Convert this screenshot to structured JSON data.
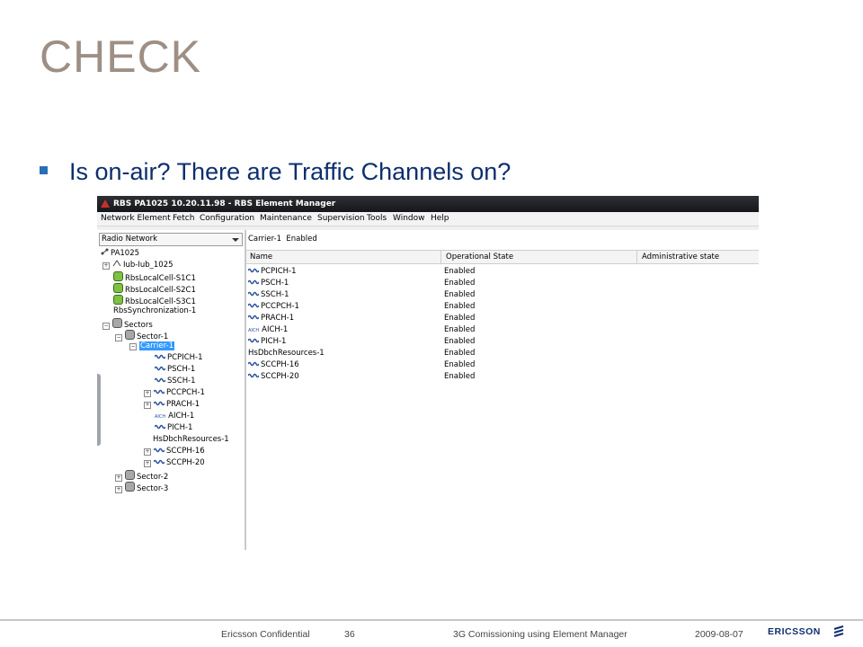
{
  "slide": {
    "title": "CHECK",
    "bullet": "Is on-air? There are Traffic Channels on?"
  },
  "window": {
    "title": "RBS PA1025 10.20.11.98 - RBS Element Manager",
    "menu": [
      "Network Element",
      "Fetch",
      "Configuration",
      "Maintenance",
      "Supervision",
      "Tools",
      "Window",
      "Help"
    ]
  },
  "tree": {
    "combo_value": "Radio Network",
    "items": [
      {
        "label": "PA1025"
      },
      {
        "label": "Iub-Iub_1025"
      },
      {
        "label": "RbsLocalCell-S1C1"
      },
      {
        "label": "RbsLocalCell-S2C1"
      },
      {
        "label": "RbsLocalCell-S3C1"
      },
      {
        "label": "RbsSynchronization-1"
      },
      {
        "label": "Sectors"
      },
      {
        "label": "Sector-1"
      },
      {
        "label": "Carrier-1"
      },
      {
        "label": "PCPICH-1"
      },
      {
        "label": "PSCH-1"
      },
      {
        "label": "SSCH-1"
      },
      {
        "label": "PCCPCH-1"
      },
      {
        "label": "PRACH-1"
      },
      {
        "label": "AICH-1"
      },
      {
        "label": "PICH-1"
      },
      {
        "label": "HsDbchResources-1"
      },
      {
        "label": "SCCPH-16"
      },
      {
        "label": "SCCPH-20"
      },
      {
        "label": "Sector-2"
      },
      {
        "label": "Sector-3"
      }
    ],
    "aich_icon_text": "AICH"
  },
  "detail": {
    "header_name": "Carrier-1",
    "header_state": "Enabled",
    "columns": [
      "Name",
      "Operational State",
      "Administrative state"
    ],
    "rows": [
      {
        "name": "PCPICH-1",
        "state": "Enabled"
      },
      {
        "name": "PSCH-1",
        "state": "Enabled"
      },
      {
        "name": "SSCH-1",
        "state": "Enabled"
      },
      {
        "name": "PCCPCH-1",
        "state": "Enabled"
      },
      {
        "name": "PRACH-1",
        "state": "Enabled"
      },
      {
        "name": "AICH-1",
        "state": "Enabled"
      },
      {
        "name": "PICH-1",
        "state": "Enabled"
      },
      {
        "name": "HsDbchResources-1",
        "state": "Enabled"
      },
      {
        "name": "SCCPH-16",
        "state": "Enabled"
      },
      {
        "name": "SCCPH-20",
        "state": "Enabled"
      }
    ]
  },
  "footer": {
    "confidential": "Ericsson Confidential",
    "page": "36",
    "doc_title": "3G Comissioning using Element Manager",
    "date": "2009-08-07",
    "logo_text": "ERICSSON"
  }
}
